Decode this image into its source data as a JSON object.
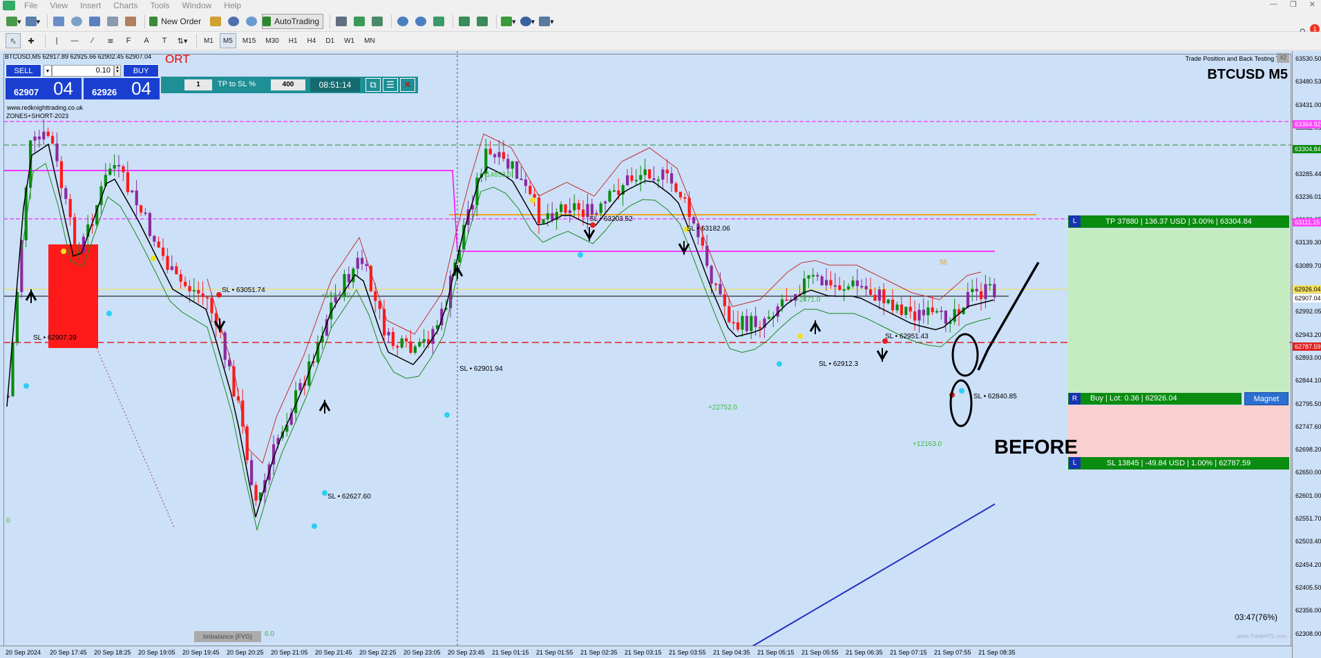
{
  "menubar": {
    "items": [
      "File",
      "View",
      "Insert",
      "Charts",
      "Tools",
      "Window",
      "Help"
    ]
  },
  "toolbar": {
    "new_order": "New Order",
    "autotrading": "AutoTrading",
    "timeframes": [
      "M1",
      "M5",
      "M15",
      "M30",
      "H1",
      "H4",
      "D1",
      "W1",
      "MN"
    ],
    "active_timeframe": "M5"
  },
  "chart": {
    "symbol_info": "BTCUSD,M5  62917.89 62925.66 62902.45 62907.04",
    "symbol_title": "BTCUSD   M5",
    "panel_title": "Trade Position and Back Testing To",
    "panel_close": "X2",
    "short_label": "ORT",
    "url": "www.redknighttrading.co.uk",
    "zones": "ZONES+SHORT-2023",
    "before_label": "BEFORE",
    "countdown": "03:47(76%)",
    "imbalance": "Imbalance (FVG)",
    "level_55": "55",
    "watermark": "www.TradeATS.com"
  },
  "oneclick": {
    "sell": "SELL",
    "buy": "BUY",
    "lot": "0.10",
    "bid_small": "62907",
    "bid_big": "04",
    "ask_small": "62926",
    "ask_big": "04"
  },
  "tpsl_bar": {
    "field1": "1",
    "label": "TP to SL %",
    "field2": "400",
    "time": "08:51:14"
  },
  "position": {
    "tp_text": "TP 37880  |  136.37 USD  |  3.00%  |  63304.84",
    "sl_text": "SL 13845  |  -49.84 USD  |  1.00%  |  62787.59",
    "entry_text": "Buy  |  Lot: 0.36  |  62926.04",
    "magnet": "Magnet",
    "tp_side": "L",
    "entry_side": "R",
    "sl_side": "L"
  },
  "sl_labels": [
    "SL • 63051.74",
    "SL • 62907.39",
    "SL • 62627.60",
    "SL • 62901.94",
    "SL • 63203.52",
    "SL • 63182.06",
    "SL • 62951.43",
    "SL • 62912.3",
    "SL • 62840.85"
  ],
  "green_labels": [
    "+14653.0",
    "+16848.0",
    "+2471.0",
    "+22752.0",
    "+12163.0",
    "6.0",
    "0"
  ],
  "price_axis": [
    "63530.50",
    "63480.53",
    "63431.00",
    "63382.05",
    "63334.74",
    "63285.44",
    "63236.01",
    "63186.65",
    "63139.30",
    "63089.70",
    "63040.33",
    "62992.05",
    "62943.20",
    "62893.00",
    "62844.10",
    "62795.50",
    "62747.60",
    "62698.20",
    "62650.00",
    "62601.00",
    "62551.70",
    "62503.40",
    "62454.20",
    "62405.50",
    "62356.00",
    "62308.00"
  ],
  "price_tags": {
    "magenta_top": "63364.92",
    "green_tp": "63304.84",
    "magenta_mid": "63111.15",
    "current": "62907.04",
    "yellow": "62926.04",
    "red_sl": "62787.59"
  },
  "time_axis": [
    "20 Sep 2024",
    "20 Sep 17:45",
    "20 Sep 18:25",
    "20 Sep 19:05",
    "20 Sep 19:45",
    "20 Sep 20:25",
    "20 Sep 21:05",
    "20 Sep 21:45",
    "20 Sep 22:25",
    "20 Sep 23:05",
    "20 Sep 23:45",
    "21 Sep 01:15",
    "21 Sep 01:55",
    "21 Sep 02:35",
    "21 Sep 03:15",
    "21 Sep 03:55",
    "21 Sep 04:35",
    "21 Sep 05:15",
    "21 Sep 05:55",
    "21 Sep 06:35",
    "21 Sep 07:15",
    "21 Sep 07:55",
    "21 Sep 08:35"
  ],
  "colors": {
    "chart_bg": "#cce0f8",
    "bull": "#0a8c10",
    "bear": "#ff1a1a",
    "purple": "#8a2aa0",
    "magenta": "#ff00ff",
    "orange": "#f0a020",
    "panel_blue": "#1a3fd0",
    "teal": "#1f8f96"
  }
}
